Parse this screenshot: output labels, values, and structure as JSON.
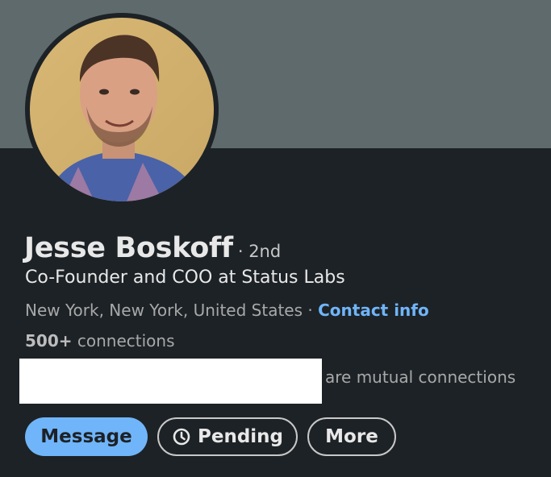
{
  "profile": {
    "name": "Jesse Boskoff",
    "degree": "· 2nd",
    "headline": "Co-Founder and COO at Status Labs",
    "location": "New York, New York, United States",
    "separator": " · ",
    "contact_info": "Contact info",
    "connections_count": "500+",
    "connections_label": " connections",
    "mutual_text": "are mutual connections"
  },
  "actions": {
    "message": "Message",
    "pending": "Pending",
    "more": "More"
  },
  "colors": {
    "accent": "#70b5f9",
    "background": "#1d2226",
    "banner": "#5e6a6b"
  },
  "icons": {
    "pending": "clock-icon"
  }
}
